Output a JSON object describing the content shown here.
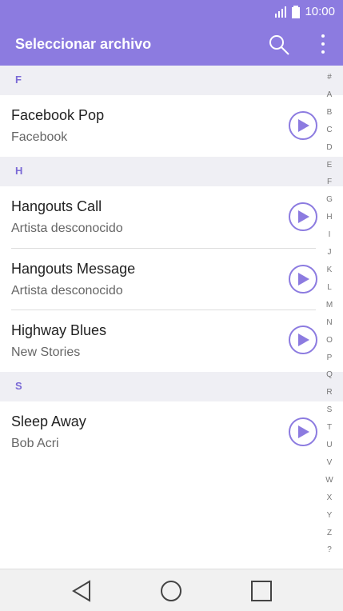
{
  "status": {
    "time": "10:00"
  },
  "appbar": {
    "title": "Seleccionar archivo"
  },
  "sections": [
    {
      "letter": "F",
      "items": [
        {
          "title": "Facebook Pop",
          "subtitle": "Facebook"
        }
      ]
    },
    {
      "letter": "H",
      "items": [
        {
          "title": "Hangouts Call",
          "subtitle": "Artista desconocido"
        },
        {
          "title": "Hangouts Message",
          "subtitle": "Artista desconocido"
        },
        {
          "title": "Highway Blues",
          "subtitle": "New Stories"
        }
      ]
    },
    {
      "letter": "S",
      "items": [
        {
          "title": "Sleep Away",
          "subtitle": "Bob Acri"
        }
      ]
    }
  ],
  "index": [
    "#",
    "A",
    "B",
    "C",
    "D",
    "E",
    "F",
    "G",
    "H",
    "I",
    "J",
    "K",
    "L",
    "M",
    "N",
    "O",
    "P",
    "Q",
    "R",
    "S",
    "T",
    "U",
    "V",
    "W",
    "X",
    "Y",
    "Z",
    "?"
  ],
  "colors": {
    "accent": "#8c7be0",
    "sectionBg": "#efeff4"
  },
  "icons": {
    "search": "search-icon",
    "more": "more-vert-icon",
    "play": "play-icon",
    "back": "back-icon",
    "home": "home-icon",
    "recents": "recents-icon"
  }
}
